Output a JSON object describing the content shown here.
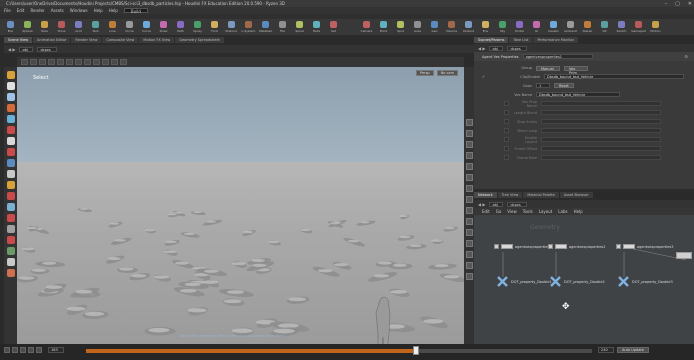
{
  "window": {
    "title": "C:/Users/user/OneDrive/Documents/Houdini Projects/CMBS/Sci-sci3_dbsdb_particles.hip - Houdini FX Education Edition 20.0.590 - Ryzen 3D",
    "controls": [
      "–",
      "▢",
      "✕"
    ]
  },
  "menubar": {
    "items": [
      "File",
      "Edit",
      "Render",
      "Assets",
      "Windows",
      "Help",
      "Help"
    ],
    "desktop": "Build"
  },
  "shelf": {
    "tools": [
      "Box",
      "Sphere",
      "Tube",
      "Torus",
      "Grid",
      "Null",
      "Line",
      "Circle",
      "Curve",
      "Draw",
      "Path",
      "Spray",
      "Font",
      "Platonic",
      "L-System",
      "Metaball",
      "File",
      "Spiral",
      "Helix",
      "Set"
    ],
    "right_tools": [
      "Camera",
      "Point",
      "Spot",
      "Area",
      "Geo",
      "Volume",
      "Distant",
      "Env",
      "Sky",
      "Portal",
      "GI",
      "Caustic",
      "Ambient",
      "Stereo",
      "VR",
      "Switch",
      "Gamepad",
      "Motion"
    ],
    "tool_colors": [
      "#6b8fbf",
      "#8bb35a",
      "#c9a04a",
      "#b85a5a",
      "#7c7cc0",
      "#5aa0a0",
      "#c07c3a",
      "#9a9a9a",
      "#6fa8dc",
      "#c46bb0",
      "#8a6bc4",
      "#4aa06a",
      "#d0b060",
      "#7a9ac0",
      "#a06a4a",
      "#5a8ac0",
      "#909090",
      "#b0c060",
      "#60b0c0",
      "#c06060"
    ]
  },
  "tabs": {
    "viewport_tabs": [
      "Scene View",
      "Animation Editor",
      "Render View",
      "Composite View",
      "Motion FX View",
      "Geometry Spreadsheet"
    ],
    "viewport_active": 0,
    "param_tabs": [
      "Sopnet/Params",
      "Take List",
      "Performance Monitor"
    ],
    "net_tabs": [
      "Network",
      "Tree View",
      "Material Palette",
      "Asset Browser"
    ]
  },
  "viewport": {
    "path_obj": "obj",
    "path_node": "dcpxs",
    "mode_label": "Select",
    "persp": "Persp",
    "cam": "No cam",
    "status": "Select the geometry. Press shortcut or spacebar to perform.",
    "left_tool_colors": [
      "#d8a23a",
      "#e0e0e0",
      "#9ec3e6",
      "#d26a3a",
      "#6ab0d8",
      "#c84a4a",
      "#d8d8d8",
      "#c84a4a",
      "#5a8ac0",
      "#c8c8c8",
      "#d8a23a",
      "#c84a4a",
      "#7ab0d0",
      "#c84a4a",
      "#a0a0a0",
      "#c84a4a",
      "#6a9a6a",
      "#c8c8c8",
      "#d07050"
    ]
  },
  "timeline": {
    "frame": "163",
    "end_frame": "240",
    "progress": 0.68,
    "accent": "#c0651b",
    "auto_update": "Auto Update"
  },
  "params": {
    "node_title": "Agent Vex Properties",
    "node_name": "agentvexproperties1",
    "group_label": "Group",
    "group_btn": "Manual",
    "class_label": "Vex Prim",
    "rows": [
      {
        "label": "Clip/Enable",
        "value": "Dbsdb_bound_bsd_Vehicle"
      },
      {
        "label": "Color",
        "value": "1"
      },
      {
        "label": "Vex Name",
        "value": "Dbsdb_bound_bsd_Vehicle"
      },
      {
        "label": "Vex Prop Name",
        "value": ""
      },
      {
        "label": "Length Blend",
        "value": ""
      },
      {
        "label": "Stop Anims",
        "value": ""
      },
      {
        "label": "Blend Loop",
        "value": ""
      },
      {
        "label": "Enable Layout",
        "value": ""
      },
      {
        "label": "Frame Offset",
        "value": ""
      },
      {
        "label": "Frame Rate",
        "value": ""
      }
    ],
    "reset_btn": "Reset",
    "enable_label": "Enable Layout"
  },
  "network": {
    "path_obj": "obj",
    "path_node": "dcpxs",
    "menu": [
      "Edit",
      "Go",
      "View",
      "Tools",
      "Layout",
      "Labs",
      "Help"
    ],
    "watermark": "Geometry",
    "nodes": [
      {
        "top": "agentvexproperties1",
        "bottom": "DOT_property_Double1"
      },
      {
        "top": "agentvexproperties2",
        "bottom": "DOT_property_Double2"
      },
      {
        "top": "agentvexproperties3",
        "bottom": "DOT_property_Double3"
      }
    ]
  }
}
